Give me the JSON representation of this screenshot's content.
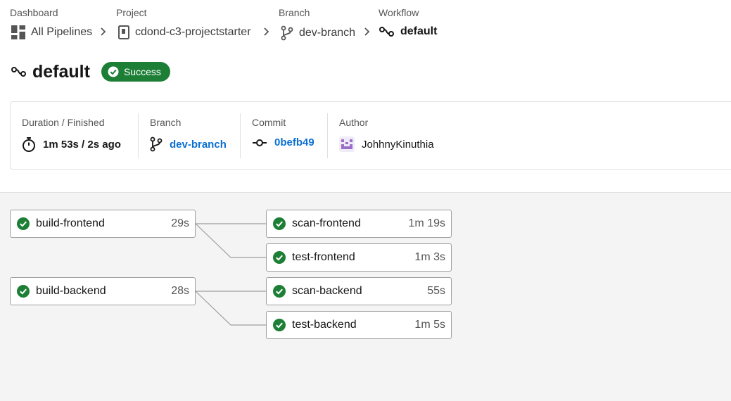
{
  "breadcrumbs": [
    {
      "label": "Dashboard",
      "value": "All Pipelines",
      "icon": "dashboard-icon"
    },
    {
      "label": "Project",
      "value": "cdond-c3-projectstarter",
      "icon": "repo-icon"
    },
    {
      "label": "Branch",
      "value": "dev-branch",
      "icon": "branch-icon"
    },
    {
      "label": "Workflow",
      "value": "default",
      "icon": "workflow-icon"
    }
  ],
  "workflow": {
    "title": "default",
    "status": "Success",
    "status_color": "#1d7f36"
  },
  "info": {
    "duration_label": "Duration / Finished",
    "duration_value": "1m 53s / 2s ago",
    "branch_label": "Branch",
    "branch_value": "dev-branch",
    "commit_label": "Commit",
    "commit_value": "0befb49",
    "author_label": "Author",
    "author_value": "JohhnyKinuthia"
  },
  "jobs": [
    {
      "name": "build-frontend",
      "duration": "29s",
      "status": "success"
    },
    {
      "name": "scan-frontend",
      "duration": "1m 19s",
      "status": "success"
    },
    {
      "name": "test-frontend",
      "duration": "1m 3s",
      "status": "success"
    },
    {
      "name": "build-backend",
      "duration": "28s",
      "status": "success"
    },
    {
      "name": "scan-backend",
      "duration": "55s",
      "status": "success"
    },
    {
      "name": "test-backend",
      "duration": "1m 5s",
      "status": "success"
    }
  ],
  "colors": {
    "success": "#1d7f36",
    "link": "#0a6fd1",
    "graph_background": "#f4f4f4"
  }
}
